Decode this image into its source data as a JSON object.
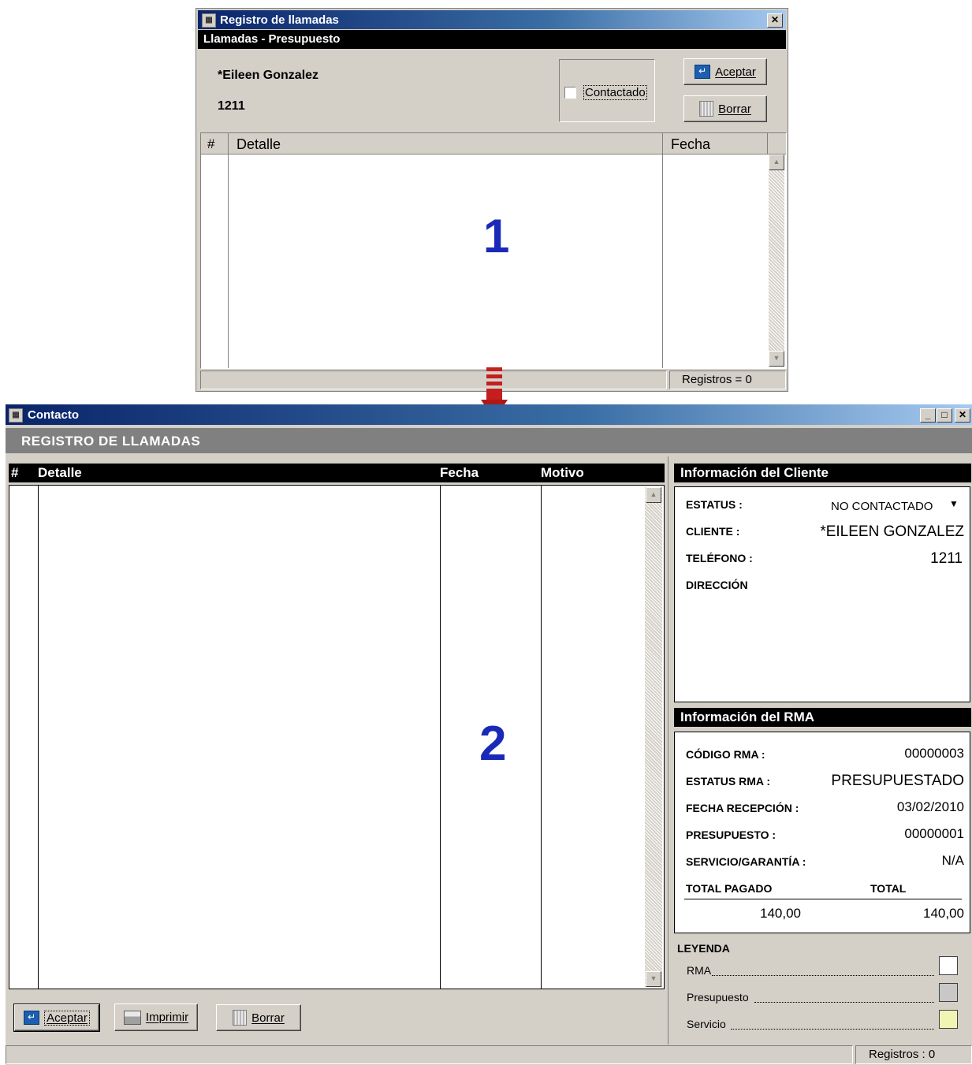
{
  "dialog1": {
    "title": "Registro de llamadas",
    "subtitle": "Llamadas - Presupuesto",
    "client_name": "*Eileen Gonzalez",
    "phone": "1211",
    "checkbox_label": "Contactado",
    "accept_label": "Aceptar",
    "delete_label": "Borrar",
    "columns": [
      "#",
      "Detalle",
      "Fecha"
    ],
    "marker": "1",
    "status": "Registros = 0"
  },
  "window2": {
    "title": "Contacto",
    "header": "REGISTRO DE LLAMADAS",
    "columns": [
      "#",
      "Detalle",
      "Fecha",
      "Motivo"
    ],
    "marker": "2",
    "buttons": {
      "accept": "Aceptar",
      "print": "Imprimir",
      "delete": "Borrar"
    },
    "status": "Registros : 0",
    "client_info": {
      "heading": "Información del Cliente",
      "status_label": "ESTATUS :",
      "status_value": "NO CONTACTADO",
      "client_label": "CLIENTE :",
      "client_value": "*EILEEN GONZALEZ",
      "phone_label": "TELÉFONO :",
      "phone_value": "1211",
      "address_label": "DIRECCIÓN"
    },
    "rma_info": {
      "heading": "Información del RMA",
      "code_label": "CÓDIGO RMA :",
      "code_value": "00000003",
      "status_label": "ESTATUS RMA :",
      "status_value": "PRESUPUESTADO",
      "date_label": "FECHA RECEPCIÓN :",
      "date_value": "03/02/2010",
      "budget_label": "PRESUPUESTO :",
      "budget_value": "00000001",
      "service_label": "SERVICIO/GARANTÍA :",
      "service_value": "N/A",
      "total_paid_label": "TOTAL PAGADO",
      "total_label": "TOTAL",
      "total_paid_value": "140,00",
      "total_value": "140,00"
    },
    "legend": {
      "heading": "LEYENDA",
      "items": [
        {
          "label": "RMA",
          "color": "#ffffff"
        },
        {
          "label": "Presupuesto",
          "color": "#c8c8c8"
        },
        {
          "label": "Servicio",
          "color": "#f0f5b4"
        }
      ]
    }
  }
}
